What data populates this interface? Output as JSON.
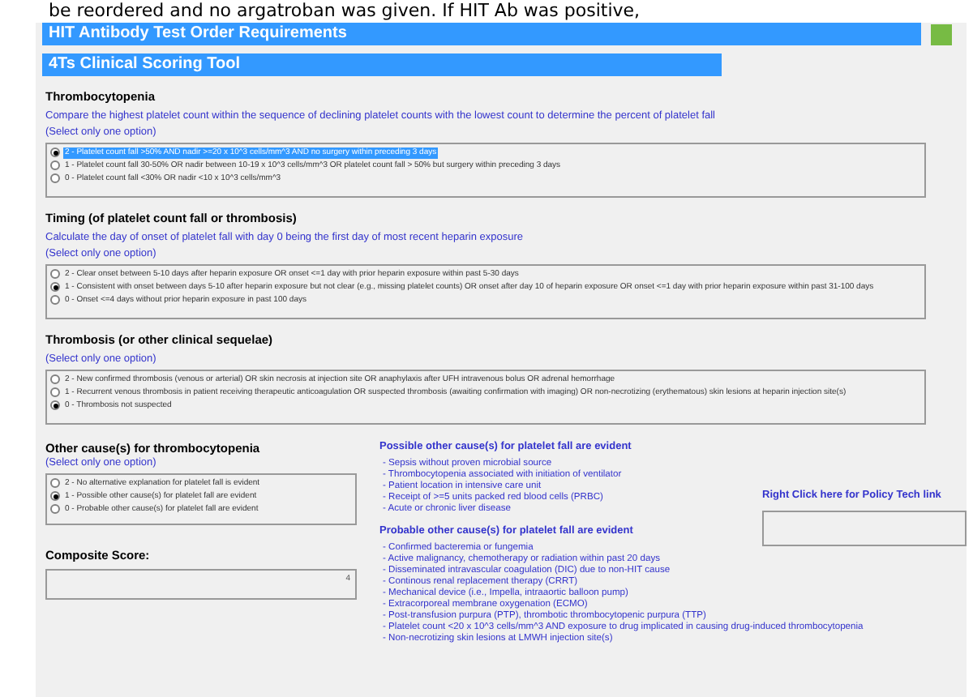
{
  "document_text_above": "be reordered and no argatroban was given. If HIT Ab was positive,",
  "header": {
    "title": "HIT Antibody Test Order Requirements",
    "subtitle": "4Ts Clinical Scoring Tool"
  },
  "sections": [
    {
      "title": "Thrombocytopenia",
      "description": "Compare the highest platelet count within the sequence of declining platelet counts with the lowest count to determine the percent of platelet fall",
      "hint": "(Select only one option)",
      "options": [
        {
          "label": "2 - Platelet count fall >50% AND nadir >=20 x 10^3 cells/mm^3 AND no surgery within preceding 3 days",
          "selected": true,
          "focused": true
        },
        {
          "label": "1 - Platelet count fall 30-50% OR nadir between 10-19 x 10^3 cells/mm^3 OR platelet count fall > 50% but surgery within preceding 3 days",
          "selected": false,
          "focused": false
        },
        {
          "label": "0 - Platelet count fall <30% OR nadir <10 x 10^3 cells/mm^3",
          "selected": false,
          "focused": false
        }
      ]
    },
    {
      "title": "Timing (of platelet count fall or thrombosis)",
      "description": "Calculate the day of onset of platelet fall with day 0 being the first day of most recent heparin exposure",
      "hint": "(Select only one option)",
      "options": [
        {
          "label": "2 - Clear onset between 5-10 days after heparin exposure OR onset <=1 day with prior heparin exposure within past 5-30 days",
          "selected": false,
          "focused": false
        },
        {
          "label": "1 - Consistent with onset between days 5-10 after heparin exposure but not clear (e.g., missing platelet counts) OR onset after day 10 of heparin exposure OR onset <=1 day with prior heparin exposure within past 31-100 days",
          "selected": true,
          "focused": false
        },
        {
          "label": "0 - Onset <=4 days without prior heparin exposure in past 100 days",
          "selected": false,
          "focused": false
        }
      ]
    },
    {
      "title": "Thrombosis (or other clinical sequelae)",
      "hint": "(Select only one option)",
      "options": [
        {
          "label": "2 - New confirmed thrombosis (venous or arterial) OR skin necrosis at injection site OR anaphylaxis after UFH intravenous bolus OR adrenal hemorrhage",
          "selected": false,
          "focused": false
        },
        {
          "label": "1 - Recurrent venous thrombosis in patient receiving therapeutic anticoagulation OR suspected thrombosis (awaiting confirmation with imaging) OR non-necrotizing (erythematous) skin lesions at heparin injection site(s)",
          "selected": false,
          "focused": false
        },
        {
          "label": "0 - Thrombosis not suspected",
          "selected": true,
          "focused": false
        }
      ]
    }
  ],
  "other_causes": {
    "title": "Other cause(s) for thrombocytopenia",
    "hint": "(Select only one option)",
    "options": [
      {
        "label": "2 - No alternative explanation for platelet fall is evident",
        "selected": false,
        "focused": false
      },
      {
        "label": "1 - Possible other cause(s) for platelet fall are evident",
        "selected": true,
        "focused": false
      },
      {
        "label": "0 - Probable other cause(s) for platelet fall are evident",
        "selected": false,
        "focused": false
      }
    ]
  },
  "composite_score": {
    "label": "Composite Score:",
    "value": "4"
  },
  "possible_causes": {
    "title": "Possible other cause(s) for platelet fall are evident",
    "items": [
      "- Sepsis without proven microbial source",
      "- Thrombocytopenia associated with initiation of ventilator",
      "- Patient location in intensive care unit",
      "- Receipt of >=5 units packed red blood cells (PRBC)",
      "- Acute or chronic liver disease"
    ]
  },
  "probable_causes": {
    "title": "Probable other cause(s) for platelet fall are evident",
    "items": [
      "- Confirmed bacteremia or fungemia",
      "- Active malignancy, chemotherapy or radiation within past 20 days",
      "- Disseminated intravascular coagulation (DIC) due to non-HIT cause",
      "- Continous renal replacement therapy (CRRT)",
      "- Mechanical device (i.e., Impella, intraaortic balloon pump)",
      "- Extracorporeal membrane oxygenation (ECMO)",
      "- Post-transfusion purpura (PTP), thrombotic thrombocytopenic purpura (TTP)",
      "- Platelet count <20 x 10^3 cells/mm^3 AND exposure to drug implicated in causing drug-induced thrombocytopenia",
      "- Non-necrotizing skin lesions at LMWH injection site(s)"
    ]
  },
  "policy_link": {
    "label": "Right Click here for Policy Tech link"
  }
}
